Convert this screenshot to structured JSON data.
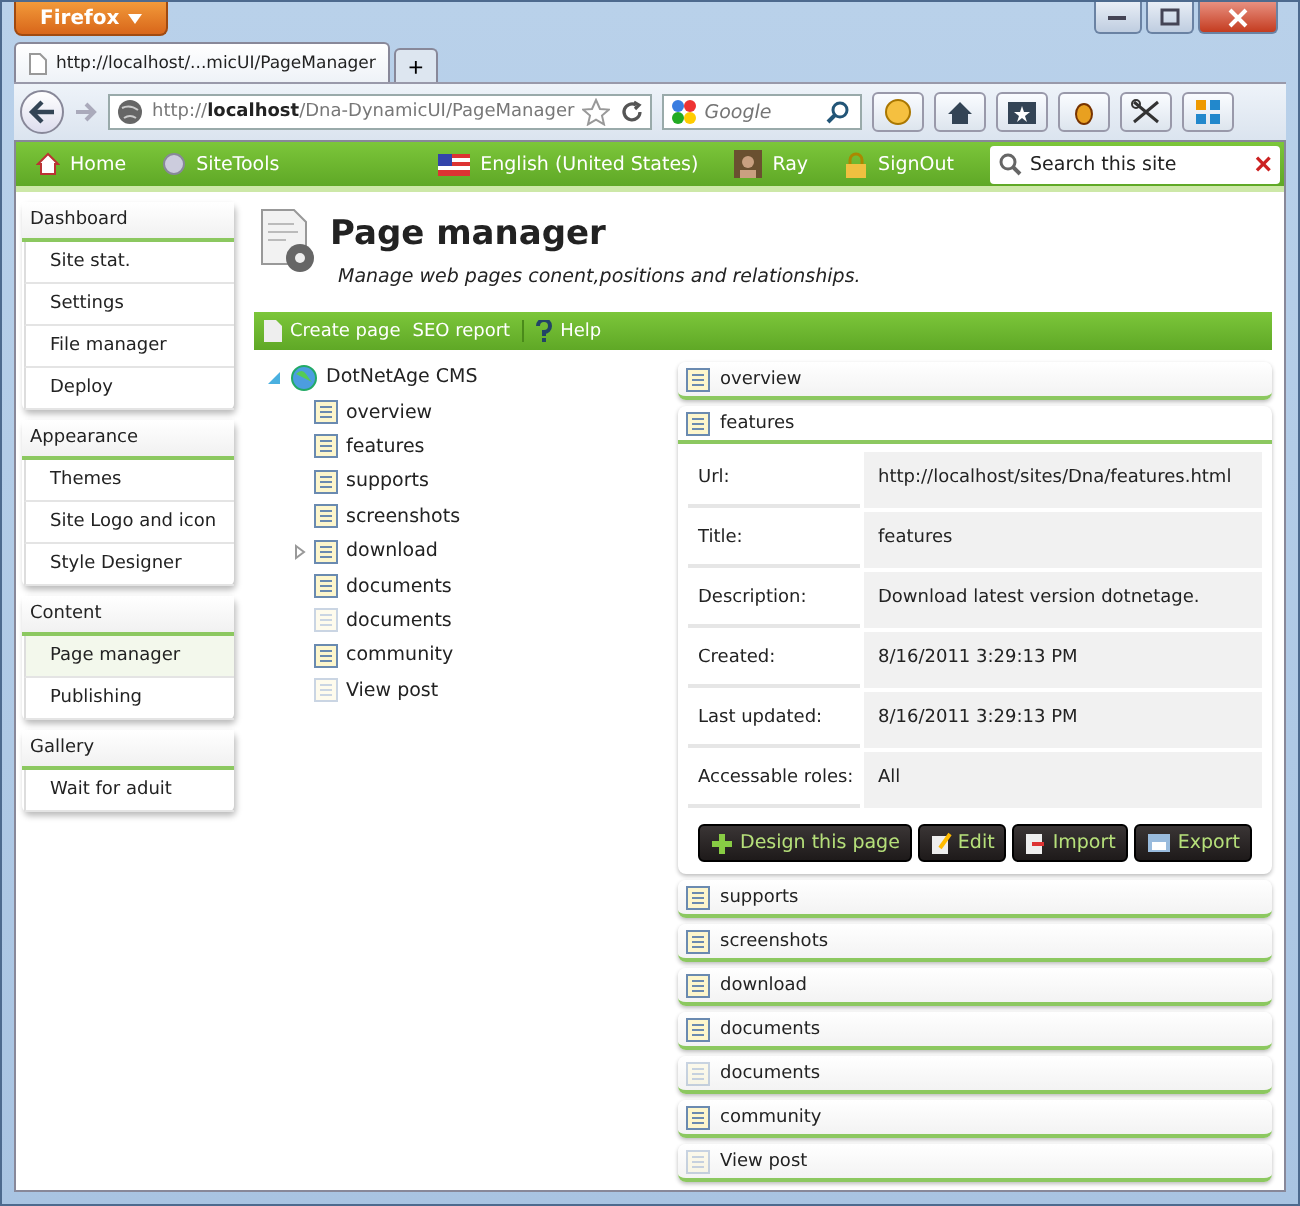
{
  "browser": {
    "menu_button": "Firefox",
    "tabs": [
      {
        "title": "http://localhost/...micUI/PageManager",
        "selected": true
      }
    ],
    "new_tab": "+",
    "address": {
      "host_prefix": "http://",
      "host": "localhost",
      "path": "/Dna-DynamicUI/PageManager"
    },
    "search": {
      "placeholder": "Google"
    }
  },
  "site_bar": {
    "items": [
      {
        "label": "Home",
        "kind": "home"
      },
      {
        "label": "SiteTools",
        "kind": "tools"
      },
      {
        "label": "English (United States)",
        "kind": "flag"
      },
      {
        "label": "Ray",
        "kind": "avatar"
      },
      {
        "label": "SignOut",
        "kind": "lock"
      }
    ],
    "search": {
      "placeholder": "Search this site"
    },
    "clear": "×"
  },
  "sidebar": [
    {
      "title": "Dashboard",
      "items": [
        {
          "label": "Site stat.",
          "selected": false
        },
        {
          "label": "Settings",
          "selected": false
        },
        {
          "label": "File manager",
          "selected": false
        },
        {
          "label": "Deploy",
          "selected": false
        }
      ]
    },
    {
      "title": "Appearance",
      "items": [
        {
          "label": "Themes",
          "selected": false
        },
        {
          "label": "Site Logo and icon",
          "selected": false
        },
        {
          "label": "Style Designer",
          "selected": false
        }
      ]
    },
    {
      "title": "Content",
      "items": [
        {
          "label": "Page manager",
          "selected": true
        },
        {
          "label": "Publishing",
          "selected": false
        }
      ]
    },
    {
      "title": "Gallery",
      "items": [
        {
          "label": "Wait for aduit",
          "selected": false
        }
      ]
    }
  ],
  "header": {
    "title": "Page manager",
    "subtitle": "Manage web pages conent,positions and relationships."
  },
  "toolbar": [
    {
      "label": "Create page",
      "kind": "page"
    },
    {
      "label": "SEO report",
      "kind": "none"
    },
    {
      "label": "Help",
      "kind": "help"
    }
  ],
  "tree": {
    "label": "DotNetAge CMS",
    "expanded": true,
    "children": [
      {
        "label": "overview",
        "faded": false,
        "expandable": false
      },
      {
        "label": "features",
        "faded": false,
        "expandable": false
      },
      {
        "label": "supports",
        "faded": false,
        "expandable": false
      },
      {
        "label": "screenshots",
        "faded": false,
        "expandable": false
      },
      {
        "label": "download",
        "faded": false,
        "expandable": true
      },
      {
        "label": "documents",
        "faded": false,
        "expandable": false
      },
      {
        "label": "documents",
        "faded": true,
        "expandable": false
      },
      {
        "label": "community",
        "faded": false,
        "expandable": false
      },
      {
        "label": "View post",
        "faded": true,
        "expandable": false
      }
    ]
  },
  "panels": [
    {
      "title": "overview",
      "faded": false,
      "expanded": false
    },
    {
      "title": "features",
      "faded": false,
      "expanded": true,
      "fields": [
        {
          "label": "Url:",
          "value": "http://localhost/sites/Dna/features.html"
        },
        {
          "label": "Title:",
          "value": "features"
        },
        {
          "label": "Description:",
          "value": "Download latest version dotnetage."
        },
        {
          "label": "Created:",
          "value": "8/16/2011 3:29:13 PM"
        },
        {
          "label": "Last updated:",
          "value": "8/16/2011 3:29:13 PM"
        },
        {
          "label": "Accessable roles:",
          "value": "All"
        }
      ],
      "buttons": [
        {
          "label": "Design this page",
          "kind": "design"
        },
        {
          "label": "Edit",
          "kind": "edit"
        },
        {
          "label": "Import",
          "kind": "import"
        },
        {
          "label": "Export",
          "kind": "export"
        }
      ]
    },
    {
      "title": "supports",
      "faded": false,
      "expanded": false
    },
    {
      "title": "screenshots",
      "faded": false,
      "expanded": false
    },
    {
      "title": "download",
      "faded": false,
      "expanded": false
    },
    {
      "title": "documents",
      "faded": false,
      "expanded": false
    },
    {
      "title": "documents",
      "faded": true,
      "expanded": false
    },
    {
      "title": "community",
      "faded": false,
      "expanded": false
    },
    {
      "title": "View post",
      "faded": true,
      "expanded": false
    }
  ]
}
